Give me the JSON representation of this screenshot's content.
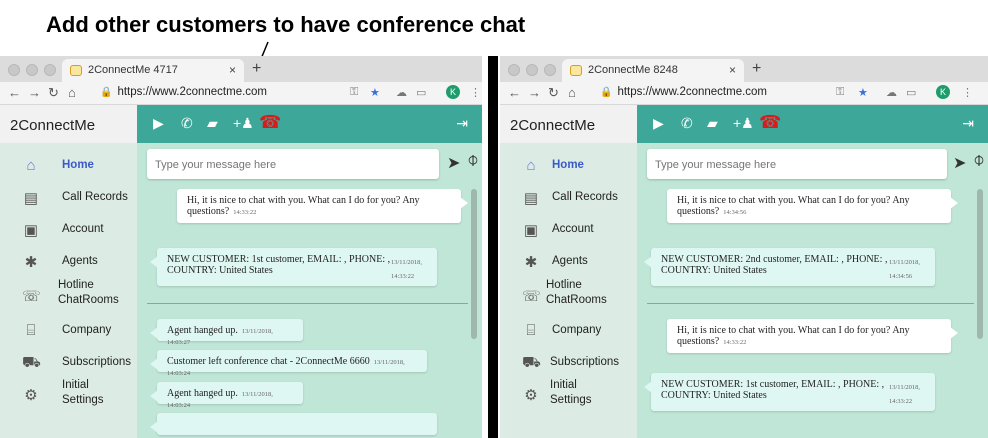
{
  "caption": "Add other customers to have conference chat",
  "left_window": {
    "tab_title": "2ConnectMe 4717",
    "tab_close": "×",
    "new_tab": "+",
    "url": "https://www.2connectme.com",
    "avatar_letter": "K",
    "brand": "2ConnectMe",
    "sidebar": [
      {
        "label": "Home",
        "icon": "home-icon",
        "glyph": "⌂"
      },
      {
        "label": "Call Records",
        "icon": "call-records-icon",
        "glyph": "▤"
      },
      {
        "label": "Account",
        "icon": "account-icon",
        "glyph": "▣"
      },
      {
        "label": "Agents",
        "icon": "agents-icon",
        "glyph": "✱"
      },
      {
        "label": "Hotline",
        "label2": "ChatRooms",
        "icon": "hotline-icon",
        "glyph": "☏"
      },
      {
        "label": "Company",
        "icon": "company-icon",
        "glyph": "⌸"
      },
      {
        "label": "Subscriptions",
        "icon": "cart-icon",
        "glyph": "⛟"
      },
      {
        "label": "Initial",
        "label2": "Settings",
        "icon": "settings-icon",
        "glyph": "⚙"
      }
    ],
    "input_placeholder": "Type your message here",
    "messages": {
      "m1_text": "Hi, it is nice to chat with you. What can I do for you? Any questions?",
      "m1_time": "14:33:22",
      "m2_line1": "NEW CUSTOMER: 1st customer, EMAIL: , PHONE: ,",
      "m2_line2": "COUNTRY: United States",
      "m2_date": "13/11/2018,",
      "m2_time": "14:33:22",
      "m3_text": "Agent hanged up.",
      "m3_ts": "13/11/2018, 14:03:27",
      "m4_text": "Customer left conference chat - 2ConnectMe 6660",
      "m4_ts": "13/11/2018, 14:03:24",
      "m5_text": "Agent hanged up.",
      "m5_ts": "13/11/2018, 14:03:24"
    }
  },
  "right_window": {
    "tab_title": "2ConnectMe 8248",
    "tab_close": "×",
    "new_tab": "+",
    "url": "https://www.2connectme.com",
    "avatar_letter": "K",
    "brand": "2ConnectMe",
    "sidebar": [
      {
        "label": "Home"
      },
      {
        "label": "Call Records"
      },
      {
        "label": "Account"
      },
      {
        "label": "Agents"
      },
      {
        "label": "Hotline",
        "label2": "ChatRooms"
      },
      {
        "label": "Company"
      },
      {
        "label": "Subscriptions"
      },
      {
        "label": "Initial",
        "label2": "Settings"
      }
    ],
    "input_placeholder": "Type your message here",
    "messages": {
      "m1_text": "Hi, it is nice to chat with you. What can I do for you? Any questions?",
      "m1_time": "14:34:56",
      "m2_line1": "NEW CUSTOMER: 2nd customer, EMAIL: , PHONE: ,",
      "m2_line2": "COUNTRY: United States",
      "m2_date": "13/11/2018,",
      "m2_time": "14:34:56",
      "m3_text": "Hi, it is nice to chat with you. What can I do for you? Any questions?",
      "m3_time": "14:33:22",
      "m4_line1": "NEW CUSTOMER: 1st customer, EMAIL: , PHONE: ,",
      "m4_line2": "COUNTRY: United States",
      "m4_date": "13/11/2018,",
      "m4_time": "14:33:22"
    }
  },
  "colors": {
    "toolbar": "#3da89a",
    "sidebar": "#dcebe4",
    "chat_bg": "#bfe6d6",
    "active_nav": "#3a5bc7",
    "hangup": "#d81b1b"
  }
}
